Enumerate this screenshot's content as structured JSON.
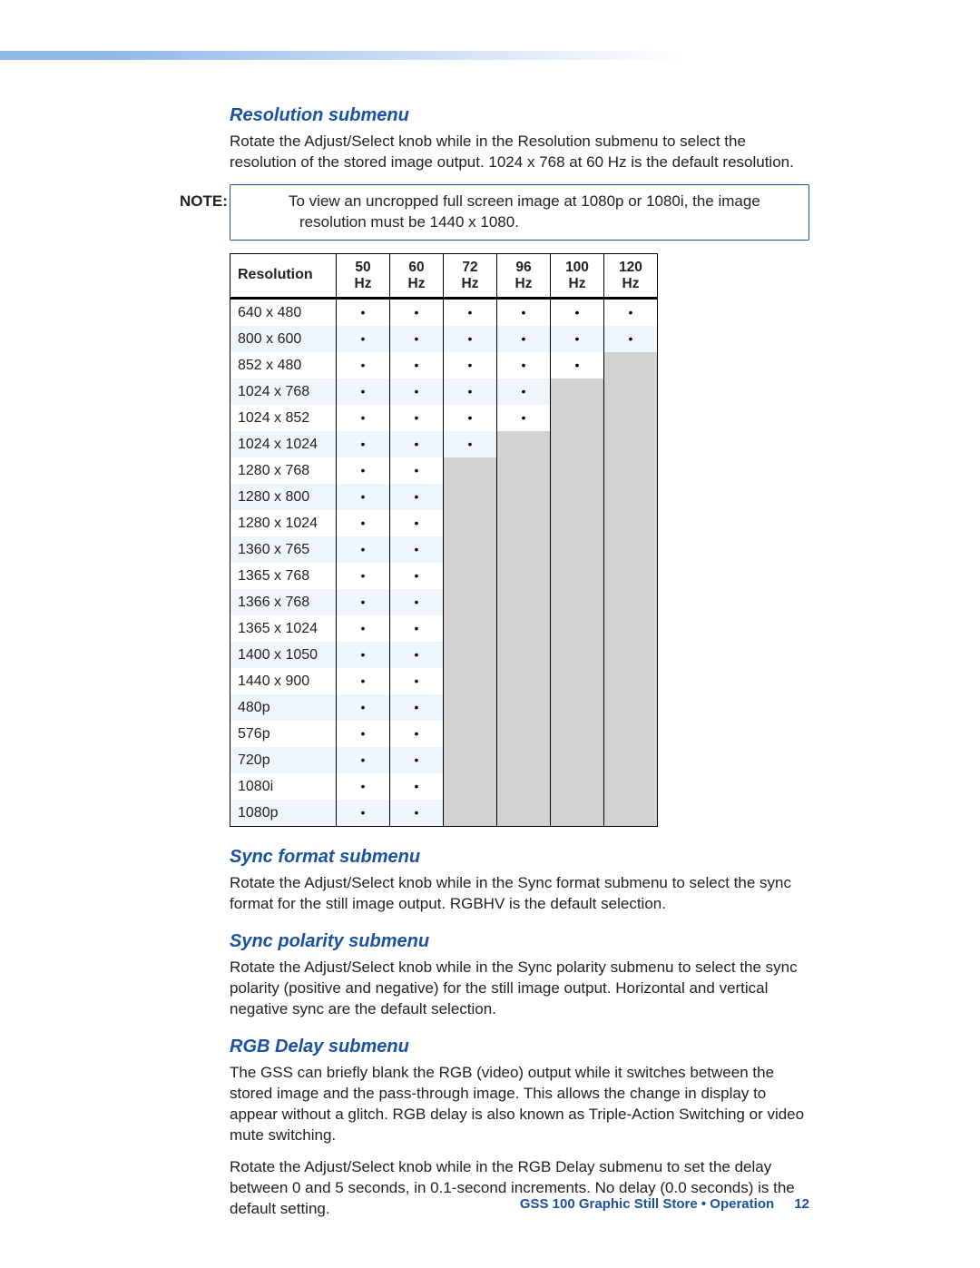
{
  "sections": {
    "resolution": {
      "title": "Resolution submenu",
      "para": "Rotate the Adjust/Select knob while in the Resolution submenu to select the resolution of the stored image output. 1024 x 768 at 60 Hz is the default resolution.",
      "note_label": "NOTE:",
      "note_text": "To view an uncropped full screen image at 1080p or 1080i, the image resolution must be 1440 x 1080."
    },
    "sync_format": {
      "title": "Sync format submenu",
      "para": "Rotate the Adjust/Select knob while in the Sync format submenu to select the sync format for the still image output. RGBHV is the default selection."
    },
    "sync_polarity": {
      "title": "Sync polarity submenu",
      "para": "Rotate the Adjust/Select knob while in the Sync polarity submenu to select the sync polarity (positive and negative) for the still image output. Horizontal and vertical negative sync are the default selection."
    },
    "rgb_delay": {
      "title": "RGB Delay submenu",
      "para1": "The GSS can briefly blank the RGB (video) output while it switches between the stored image and the pass-through image. This allows the change in display to appear without a glitch. RGB delay is also known as Triple-Action Switching or video mute switching.",
      "para2": "Rotate the Adjust/Select knob while in the RGB Delay submenu to set the delay between 0 and 5 seconds, in 0.1-second increments. No delay (0.0 seconds) is the default setting."
    }
  },
  "table": {
    "header_first": "Resolution",
    "hz_columns": [
      "50 Hz",
      "60 Hz",
      "72 Hz",
      "96 Hz",
      "100 Hz",
      "120 Hz"
    ],
    "rows": [
      {
        "label": "640 x 480",
        "cells": [
          "dot",
          "dot",
          "dot",
          "dot",
          "dot",
          "dot"
        ]
      },
      {
        "label": "800 x 600",
        "cells": [
          "dot",
          "dot",
          "dot",
          "dot",
          "dot",
          "dot"
        ]
      },
      {
        "label": "852 x 480",
        "cells": [
          "dot",
          "dot",
          "dot",
          "dot",
          "dot",
          "na"
        ]
      },
      {
        "label": "1024 x 768",
        "cells": [
          "dot",
          "dot",
          "dot",
          "dot",
          "na",
          "na"
        ]
      },
      {
        "label": "1024 x 852",
        "cells": [
          "dot",
          "dot",
          "dot",
          "dot",
          "na",
          "na"
        ]
      },
      {
        "label": "1024 x 1024",
        "cells": [
          "dot",
          "dot",
          "dot",
          "na",
          "na",
          "na"
        ]
      },
      {
        "label": "1280 x 768",
        "cells": [
          "dot",
          "dot",
          "na",
          "na",
          "na",
          "na"
        ]
      },
      {
        "label": "1280 x 800",
        "cells": [
          "dot",
          "dot",
          "na",
          "na",
          "na",
          "na"
        ]
      },
      {
        "label": "1280 x 1024",
        "cells": [
          "dot",
          "dot",
          "na",
          "na",
          "na",
          "na"
        ]
      },
      {
        "label": "1360 x 765",
        "cells": [
          "dot",
          "dot",
          "na",
          "na",
          "na",
          "na"
        ]
      },
      {
        "label": "1365 x 768",
        "cells": [
          "dot",
          "dot",
          "na",
          "na",
          "na",
          "na"
        ]
      },
      {
        "label": "1366 x 768",
        "cells": [
          "dot",
          "dot",
          "na",
          "na",
          "na",
          "na"
        ]
      },
      {
        "label": "1365 x 1024",
        "cells": [
          "dot",
          "dot",
          "na",
          "na",
          "na",
          "na"
        ]
      },
      {
        "label": "1400 x 1050",
        "cells": [
          "dot",
          "dot",
          "na",
          "na",
          "na",
          "na"
        ]
      },
      {
        "label": "1440 x 900",
        "cells": [
          "dot",
          "dot",
          "na",
          "na",
          "na",
          "na"
        ]
      },
      {
        "label": "480p",
        "cells": [
          "dot",
          "dot",
          "na",
          "na",
          "na",
          "na"
        ]
      },
      {
        "label": "576p",
        "cells": [
          "dot",
          "dot",
          "na",
          "na",
          "na",
          "na"
        ]
      },
      {
        "label": "720p",
        "cells": [
          "dot",
          "dot",
          "na",
          "na",
          "na",
          "na"
        ]
      },
      {
        "label": "1080i",
        "cells": [
          "dot",
          "dot",
          "na",
          "na",
          "na",
          "na"
        ]
      },
      {
        "label": "1080p",
        "cells": [
          "dot",
          "dot",
          "na",
          "na",
          "na",
          "na"
        ]
      }
    ]
  },
  "footer": {
    "text": "GSS 100 Graphic Still Store • Operation",
    "page": "12"
  }
}
